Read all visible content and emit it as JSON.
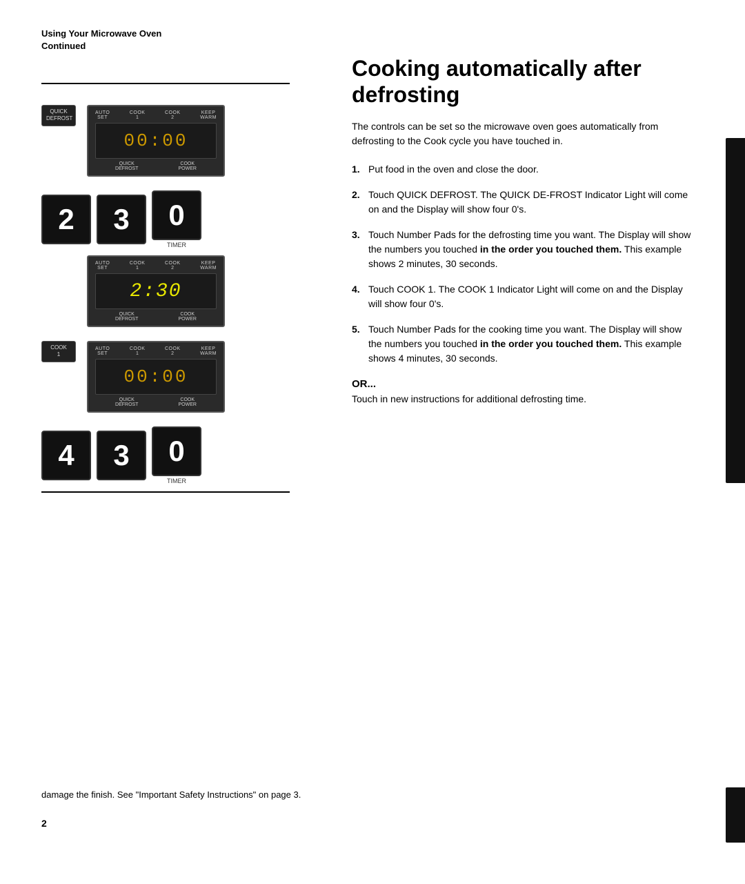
{
  "header": {
    "line1": "Using Your Microwave Oven",
    "line2": "Continued"
  },
  "title": "Cooking automatically after defrosting",
  "intro": "The controls can be set so the microwave oven goes automatically from defrosting to the Cook cycle you have touched in.",
  "steps": [
    {
      "number": "1.",
      "text": "Put food in the oven and close the door."
    },
    {
      "number": "2.",
      "text_before": "Touch QUICK DEFROST. The QUICK DE-FROST Indicator Light will come on and the Display will show four 0's."
    },
    {
      "number": "3.",
      "text_before": "Touch Number Pads for the defrosting time you want. The Display will show the numbers you touched ",
      "bold": "in the order you touched them.",
      "text_after": " This example shows 2 minutes, 30 seconds."
    },
    {
      "number": "4.",
      "text": "Touch COOK 1. The COOK 1 Indicator Light will come on and the Display will show four 0's."
    },
    {
      "number": "5.",
      "text_before": "Touch Number Pads for the cooking time you want. The Display will show the numbers you touched ",
      "bold": "in the order you touched them.",
      "text_after": " This example shows 4 minutes, 30 seconds."
    }
  ],
  "or_label": "OR...",
  "or_text": "Touch in new instructions for additional defrosting time.",
  "panel1": {
    "top_labels": [
      "AUTO SET",
      "COOK 1",
      "COOK 2",
      "KEEP WARM"
    ],
    "display": "00:00",
    "bottom_labels": [
      "QUICK DEFROST",
      "COOK POWER"
    ]
  },
  "panel2": {
    "top_labels": [
      "AUTO SET",
      "COOK 1",
      "COOK 2",
      "KEEP WARM"
    ],
    "display": "2:30",
    "bottom_labels": [
      "QUICK DEFROST",
      "COOK POWER"
    ]
  },
  "panel3": {
    "top_labels": [
      "AUTO SET",
      "COOK 1",
      "COOK 2",
      "KEEP WARM"
    ],
    "display": "00:00",
    "bottom_labels": [
      "QUICK DEFROST",
      "COOK POWER"
    ]
  },
  "buttons_row1": [
    "2",
    "3",
    "0"
  ],
  "buttons_row2": [
    "4",
    "3",
    "0"
  ],
  "small_buttons": {
    "quick_defrost": "QUICK\nDEFROST",
    "cook_1": "COOK\n1",
    "timer": "TIMER"
  },
  "bottom_text": "damage the finish. See \"Important Safety Instructions\" on page 3.",
  "page_number": "2"
}
